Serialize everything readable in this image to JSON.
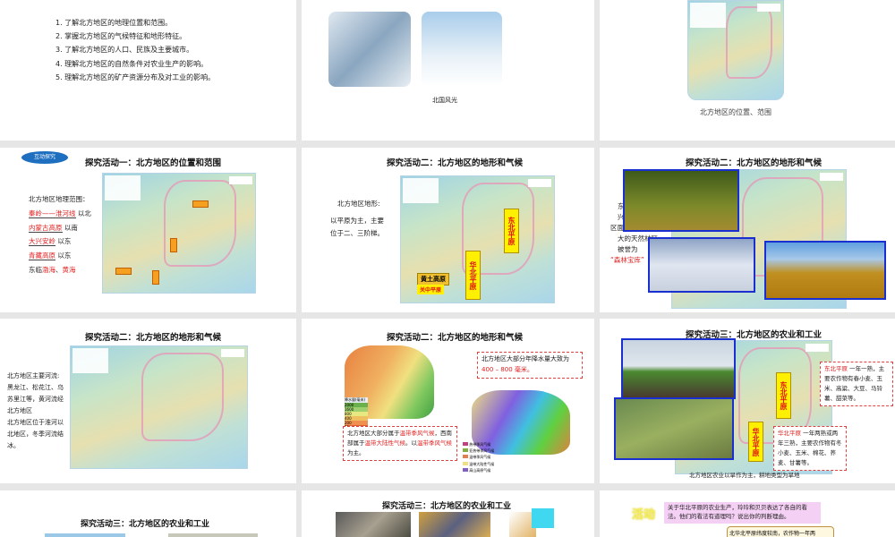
{
  "slides": [
    {
      "objectives": [
        "1. 了解北方地区的地理位置和范围。",
        "2. 掌握北方地区的气候特征和地形特征。",
        "3. 了解北方地区的人口、民族及主要城市。",
        "4. 理解北方地区的自然条件对农业生产的影响。",
        "5. 理解北方地区的矿产资源分布及对工业的影响。"
      ]
    },
    {
      "caption": "北国风光"
    },
    {
      "caption": "北方地区的位置、范围"
    },
    {
      "badge": "互动探究",
      "title": "探究活动一：北方地区的位置和范围",
      "intro": "北方地区地理范围：",
      "lines": [
        {
          "fill": "秦岭——淮河线",
          "suffix": "以北"
        },
        {
          "fill": "内蒙古高原",
          "suffix": "以南"
        },
        {
          "fill": "大兴安岭",
          "suffix": "以东"
        },
        {
          "fill": "青藏高原",
          "suffix": "以东"
        }
      ],
      "coast_prefix": "东临",
      "coast": [
        "渤海",
        "黄海"
      ]
    },
    {
      "title": "探究活动二：北方地区的地形和气候",
      "label": "北方地区地形:",
      "text": "以平原为主，主要位于二、三阶梯。",
      "plains": [
        "东北平原",
        "华北平原",
        "黄土高原",
        "关中平原"
      ]
    },
    {
      "title": "探究活动二：北方地区的地形和气候",
      "text_a": "东",
      "text_b": "兴",
      "text_c": "区面积最",
      "text_d": "大的天然林区",
      "text_e": "被誉为",
      "highlight": "“森林宝库”"
    },
    {
      "title": "探究活动二：北方地区的地形和气候",
      "text": [
        "北方地区主要河流:",
        "黑龙江、松花江、乌苏里江等，黄河流经北方地区",
        "北方地区位于淮河以北地区，冬季河流结冰。"
      ]
    },
    {
      "title": "探究活动二：北方地区的地形和气候",
      "rain_prefix": "北方地区大部分年降水量大致为",
      "rain": "400 – 800 毫米。",
      "climate_a": "北方地区大部分属于",
      "climate_b": "温带季风气候",
      "climate_c": "，西南部属于",
      "climate_d": "温带大陆性气候",
      "climate_e": "。以",
      "climate_f": "温带季风气候",
      "climate_g": "为主。",
      "legend_title": "降水量(毫米)",
      "legend_values": [
        "2000",
        "1600",
        "800",
        "400",
        "200",
        "50"
      ],
      "climate_legend": [
        "热带季风气候",
        "亚热带季风气候",
        "温带季风气候",
        "温带大陆性气候",
        "高山高原气候"
      ]
    },
    {
      "title": "探究活动三：北方地区的农业和工业",
      "ne_plain": "东北平原",
      "ne_text": "一年一熟，主要农作物有春小麦、玉米、高粱、大豆、马铃薯、甜菜等。",
      "nc_plain": "华北平原",
      "nc_text": "一年两熟或两年三熟，主要农作物有冬小麦、玉米、棉花、荞麦、甘薯等。",
      "box_ne": "东北平原",
      "box_nc": "华北平原",
      "caption": "北方地区农业以旱作为主，耕地类型为旱地"
    },
    {
      "title": "探究活动三：北方地区的农业和工业"
    },
    {
      "title": "探究活动三：北方地区的农业和工业"
    },
    {
      "activity": "活动",
      "question": "关于华北平原的农业生产，玲玲和贝贝表达了各自的看法。他们的看法有道理吗？说出你的判断理由。",
      "answer": "北华北平原纬度较南，农作物一年两"
    }
  ]
}
